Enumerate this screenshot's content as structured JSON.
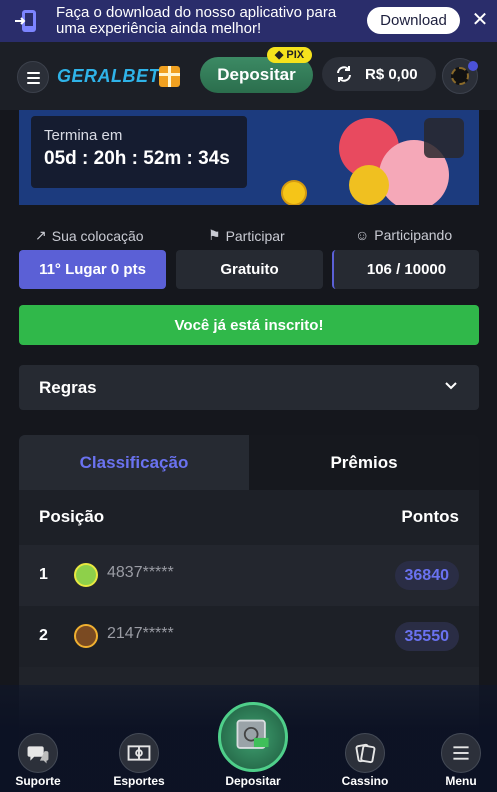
{
  "app_banner": {
    "text": "Faça o download do nosso aplicativo para uma experiência ainda melhor!",
    "download_label": "Download",
    "close_label": "✕"
  },
  "header": {
    "logo_part1": "GERAL",
    "logo_part2": "BET",
    "deposit_label": "Depositar",
    "pix_label": "PIX",
    "balance": "R$ 0,00"
  },
  "promo": {
    "ends_label": "Termina em",
    "countdown": "05d : 20h : 52m : 34s"
  },
  "stats": {
    "placing_label": "Sua colocação",
    "placing_value": "11° Lugar 0 pts",
    "entry_label": "Participar",
    "entry_value": "Gratuito",
    "participants_label": "Participando",
    "participants_value": "106 / 10000"
  },
  "registered_label": "Você já está inscrito!",
  "rules_label": "Regras",
  "leaderboard": {
    "tabs": [
      "Classificação",
      "Prêmios"
    ],
    "col_position": "Posição",
    "col_points": "Pontos",
    "rows": [
      {
        "pos": "1",
        "name": "4837*****",
        "points": "36840"
      },
      {
        "pos": "2",
        "name": "2147*****",
        "points": "35550"
      }
    ]
  },
  "bottom_nav": {
    "support": "Suporte",
    "sports": "Esportes",
    "deposit": "Depositar",
    "casino": "Cassino",
    "menu": "Menu"
  },
  "colors": {
    "accent": "#5b60d6",
    "success": "#30b84a",
    "background": "#15171d"
  }
}
